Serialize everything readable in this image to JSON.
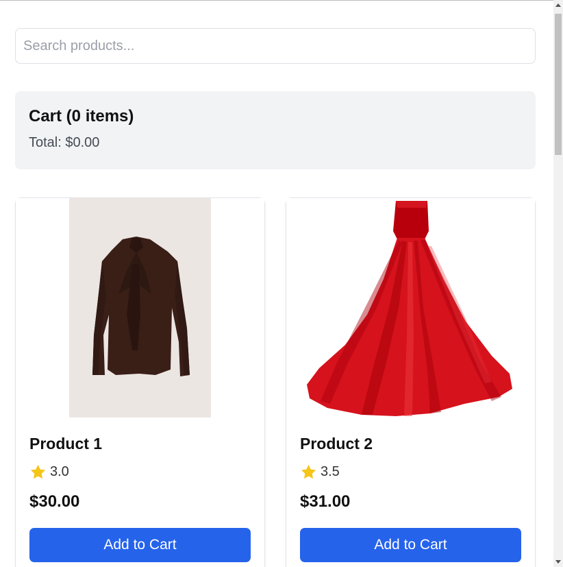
{
  "search": {
    "placeholder": "Search products..."
  },
  "cart": {
    "title": "Cart (0 items)",
    "total": "Total: $0.00"
  },
  "products": [
    {
      "name": "Product 1",
      "rating": "3.0",
      "price": "$30.00",
      "button_label": "Add to Cart",
      "image": "brown-blouse-image"
    },
    {
      "name": "Product 2",
      "rating": "3.5",
      "price": "$31.00",
      "button_label": "Add to Cart",
      "image": "red-ballgown-image"
    }
  ],
  "colors": {
    "accent": "#2563eb",
    "star": "#f5c518",
    "cart_bg": "#f2f3f5"
  },
  "icons": {
    "rating": "star-icon"
  }
}
